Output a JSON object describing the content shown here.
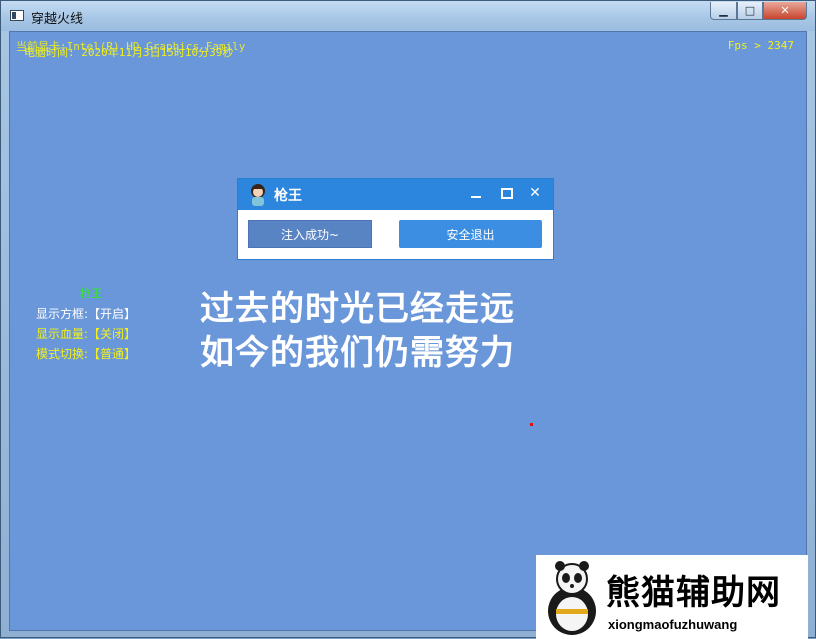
{
  "window": {
    "title": "穿越火线",
    "controls": {
      "minimize": "▁",
      "maximize": "□",
      "close": "✕"
    }
  },
  "overlay": {
    "line1": "当前显卡:Intel(R) HD Graphics Family",
    "line2": "电脑时间: 2020年11月3日15时10分39秒",
    "fps_label": "Fps > 2347"
  },
  "menu": {
    "title": "枪王",
    "items": [
      {
        "label": "显示方框:",
        "value": "【开启】"
      },
      {
        "label": "显示血量:",
        "value": "【关闭】"
      },
      {
        "label": "模式切换:",
        "value": "【普通】"
      }
    ]
  },
  "slogan": {
    "line1": "过去的时光已经走远",
    "line2": "如今的我们仍需努力"
  },
  "dialog": {
    "title": "枪王",
    "inject_button": "注入成功~",
    "exit_button": "安全退出"
  },
  "watermark": {
    "title": "熊猫辅助网",
    "url": "xiongmaofuzhuwang"
  },
  "colors": {
    "game_bg": "#6a97d9",
    "overlay_yellow": "#f2f01c",
    "menu_green": "#33e633",
    "dialog_blue": "#2c86de"
  }
}
